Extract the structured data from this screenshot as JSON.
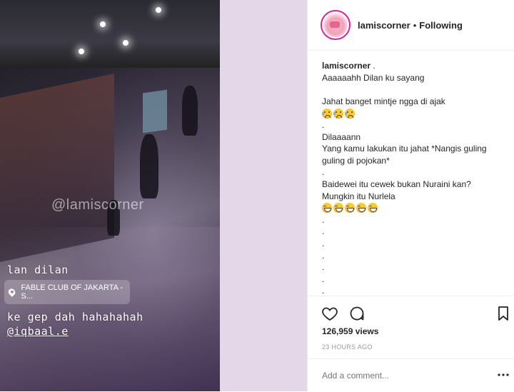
{
  "story": {
    "watermark": "@lamiscorner",
    "line1": "lan dilan",
    "location": "FABLE CLUB OF JAKARTA - S...",
    "line2": "ke gep dah hahahahah",
    "mention": "@iqbaal.e"
  },
  "header": {
    "username": "lamiscorner",
    "separator": "•",
    "follow_status": "Following"
  },
  "caption": {
    "username": "lamiscorner",
    "username_suffix": " .",
    "lines": [
      "Aaaaaahh Dilan ku sayang",
      "",
      "Jahat banget mintje ngga di ajak",
      "[sad-emoji-row]",
      ".",
      "Dilaaaann",
      "Yang kamu lakukan itu jahat *Nangis guling",
      "guling di pojokan*",
      ".",
      "Baidewei itu cewek bukan Nuraini kan?",
      "Mungkin itu Nurlela",
      "[laugh-emoji-row]",
      ".",
      ".",
      ".",
      ".",
      ".",
      ".",
      "."
    ],
    "sad_emoji_count": 3,
    "laugh_emoji_count": 5
  },
  "stats": {
    "views": "126,959 views",
    "time": "23 HOURS AGO"
  },
  "comment": {
    "placeholder": "Add a comment..."
  },
  "icons": {
    "like": "heart-icon",
    "comment": "comment-icon",
    "save": "bookmark-icon",
    "more": "more-options-icon",
    "location": "location-pin-icon"
  },
  "colors": {
    "strip": "#e4d7e7",
    "text": "#262626",
    "muted": "#999999"
  }
}
